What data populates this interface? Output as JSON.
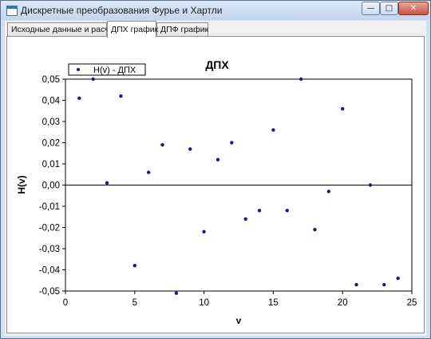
{
  "window": {
    "title": "Дискретные преобразования Фурье и Хартли",
    "controls": {
      "minimize": "—",
      "maximize": "□",
      "close": "✕"
    }
  },
  "tabs": [
    {
      "label": "Исходные данные и расчёт",
      "active": false
    },
    {
      "label": "ДПХ график",
      "active": true
    },
    {
      "label": "ДПФ график",
      "active": false
    }
  ],
  "chart_data": {
    "type": "scatter",
    "title": "ДПХ",
    "xlabel": "v",
    "ylabel": "H(v)",
    "xlim": [
      0,
      25
    ],
    "ylim": [
      -0.05,
      0.05
    ],
    "xticks": [
      "0",
      "5",
      "10",
      "15",
      "20",
      "25"
    ],
    "yticks": [
      "0,05",
      "0,04",
      "0,03",
      "0,02",
      "0,01",
      "0,00",
      "-0,01",
      "-0,02",
      "-0,03",
      "-0,04",
      "-0,05"
    ],
    "grid": false,
    "legend_position": "top-left",
    "series": [
      {
        "name": "H(v) - ДПХ",
        "color": "#1a1a8c",
        "x": [
          1,
          2,
          3,
          4,
          5,
          6,
          7,
          8,
          9,
          10,
          11,
          12,
          13,
          14,
          15,
          16,
          17,
          18,
          19,
          20,
          21,
          22,
          23,
          24
        ],
        "y": [
          0.041,
          0.05,
          0.001,
          0.042,
          -0.038,
          0.006,
          0.019,
          -0.051,
          0.017,
          -0.022,
          0.012,
          0.02,
          -0.016,
          -0.012,
          0.026,
          -0.012,
          0.05,
          -0.021,
          -0.003,
          0.036,
          -0.047,
          0.0,
          -0.047,
          -0.044
        ]
      }
    ]
  }
}
